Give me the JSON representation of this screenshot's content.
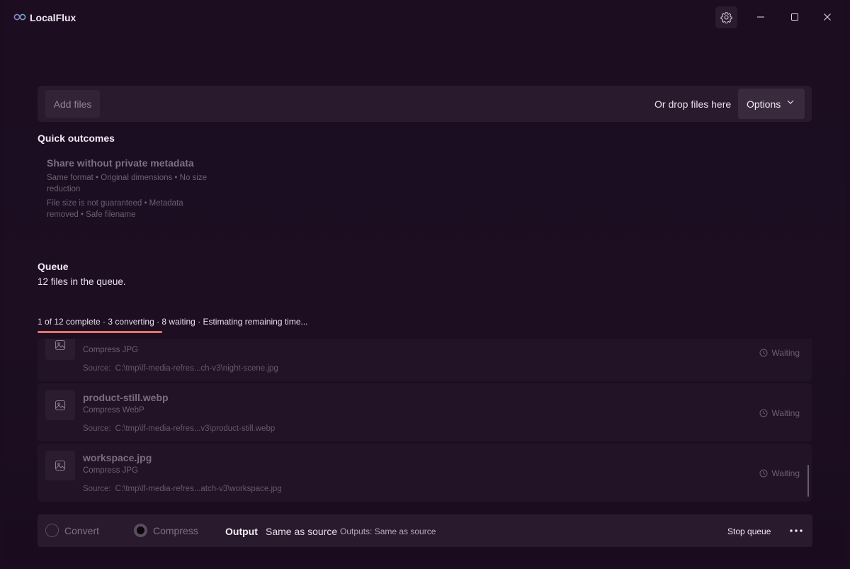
{
  "app": {
    "title": "LocalFlux"
  },
  "add_bar": {
    "add_files_label": "Add files",
    "drop_text": "Or drop files here",
    "options_label": "Options"
  },
  "quick_outcomes": {
    "title": "Quick outcomes",
    "card": {
      "title": "Share without private metadata",
      "line1": "Same format • Original dimensions • No size reduction",
      "line2": "File size is not guaranteed • Metadata removed • Safe filename"
    }
  },
  "queue": {
    "title": "Queue",
    "subtitle": "12 files in the queue.",
    "progress_text": "1 of 12 complete · 3 converting · 8 waiting · Estimating remaining time...",
    "progress_fraction": 0.083,
    "source_label": "Source:",
    "items": [
      {
        "name": "",
        "task": "Compress JPG",
        "source": "C:\\tmp\\lf-media-refres...ch-v3\\night-scene.jpg",
        "status": "Waiting"
      },
      {
        "name": "product-still.webp",
        "task": "Compress WebP",
        "source": "C:\\tmp\\lf-media-refres...v3\\product-still.webp",
        "status": "Waiting"
      },
      {
        "name": "workspace.jpg",
        "task": "Compress JPG",
        "source": "C:\\tmp\\lf-media-refres...atch-v3\\workspace.jpg",
        "status": "Waiting"
      }
    ]
  },
  "bottom_bar": {
    "mode_convert": "Convert",
    "mode_compress": "Compress",
    "selected_mode": "Compress",
    "output_label": "Output",
    "output_value": "Same as source",
    "outputs_note": "Outputs: Same as source",
    "stop_label": "Stop queue"
  },
  "colors": {
    "background": "#1b0d1f",
    "panel": "#2a1a2d",
    "progress_accent": "#e2736a"
  },
  "icons": {
    "logo": "infinity-logo-icon",
    "settings": "gear-icon",
    "minimize": "minimize-icon",
    "maximize": "maximize-icon",
    "close": "close-icon",
    "options": "chevron-down-icon",
    "thumb": "image-icon",
    "status": "clock-icon",
    "more": "more-horizontal-icon"
  }
}
